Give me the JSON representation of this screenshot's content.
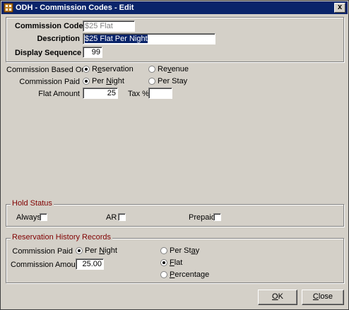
{
  "window": {
    "title": "ODH - Commission Codes - Edit",
    "close_glyph": "x"
  },
  "header_group": {
    "commission_code_label": "Commission Code",
    "commission_code_value": "$25 Flat",
    "description_label": "Description",
    "description_value": "$25 Flat Per Night",
    "display_sequence_label": "Display Sequence",
    "display_sequence_value": "99"
  },
  "commission_based_on": {
    "label": "Commission Based On",
    "options": [
      {
        "label": "Reservation",
        "mnemonic": "s",
        "selected": true
      },
      {
        "label": "Revenue",
        "mnemonic": "v",
        "selected": false
      }
    ]
  },
  "commission_paid": {
    "label": "Commission Paid",
    "options": [
      {
        "label": "Per Night",
        "mnemonic": "N",
        "selected": true
      },
      {
        "label": "Per Stay",
        "mnemonic": "",
        "selected": false
      }
    ]
  },
  "flat_amount": {
    "label": "Flat Amount",
    "value": "25"
  },
  "tax_percent": {
    "label": "Tax %",
    "value": ""
  },
  "hold_status": {
    "title": "Hold Status",
    "always_label": "Always",
    "always_checked": false,
    "ar_label": "AR",
    "ar_checked": false,
    "prepaid_label": "Prepaid",
    "prepaid_checked": false
  },
  "reservation_history": {
    "title": "Reservation History Records",
    "commission_paid_label": "Commission Paid",
    "paid_options": [
      {
        "label": "Per Night",
        "selected": true
      },
      {
        "label": "Per Stay",
        "selected": false
      }
    ],
    "commission_amount_label": "Commission Amount",
    "commission_amount_value": "25.00",
    "type_options": [
      {
        "label": "Flat",
        "selected": true
      },
      {
        "label": "Percentage",
        "selected": false
      }
    ]
  },
  "buttons": {
    "ok": "OK",
    "close": "Close"
  },
  "colors": {
    "titlebar": "#0a246a",
    "dialog_bg": "#d4d0c8",
    "group_title": "#800000"
  }
}
